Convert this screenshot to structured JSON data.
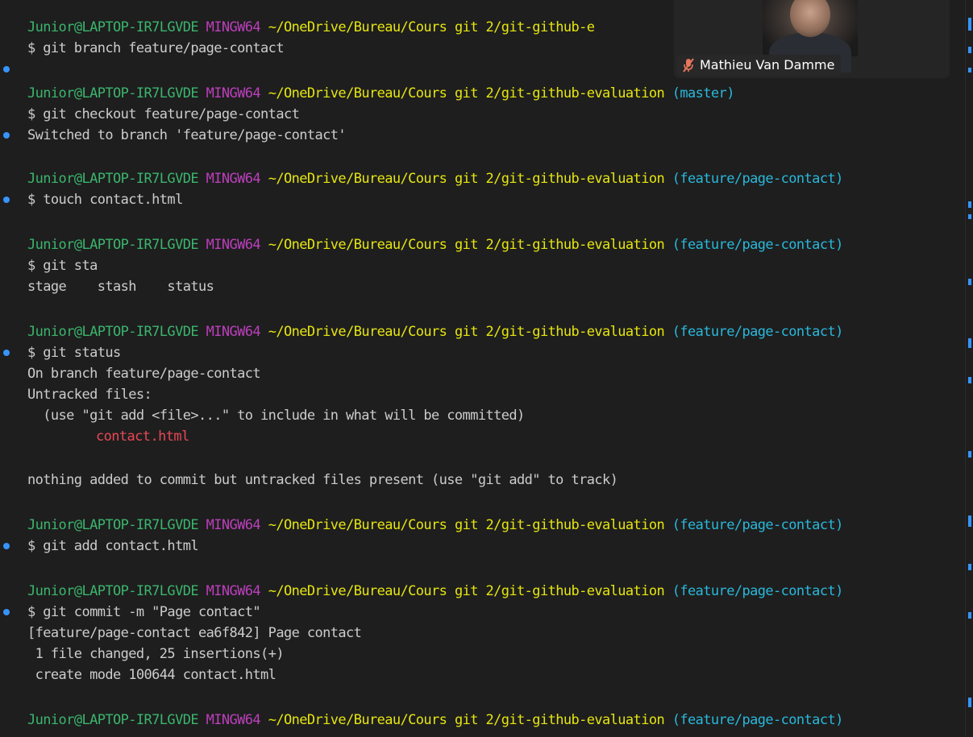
{
  "prompt": {
    "user": "Junior",
    "host": "@LAPTOP-IR7LGVDE",
    "system": "MINGW64",
    "path": "~/OneDrive/Bureau/Cours git 2/git-github-evaluation",
    "path_truncated": "~/OneDrive/Bureau/Cours git 2/git-github-e",
    "branch_master": "(master)",
    "branch_feature": "(feature/page-contact)"
  },
  "commands": {
    "c1": "$ git branch feature/page-contact",
    "c2": "$ git checkout feature/page-contact",
    "c3": "$ touch contact.html",
    "c4": "$ git sta",
    "c5": "$ git status",
    "c6": "$ git add contact.html",
    "c7": "$ git commit -m \"Page contact\""
  },
  "outputs": {
    "switched": "Switched to branch 'feature/page-contact'",
    "completions": "stage    stash    status",
    "on_branch": "On branch feature/page-contact",
    "untracked_header": "Untracked files:",
    "untracked_hint": "  (use \"git add <file>...\" to include in what will be committed)",
    "untracked_file": "contact.html",
    "nothing_added": "nothing added to commit but untracked files present (use \"git add\" to track)",
    "commit_header": "[feature/page-contact ea6f842] Page contact",
    "commit_stats": " 1 file changed, 25 insertions(+)",
    "commit_mode": " create mode 100644 contact.html"
  },
  "video_call": {
    "participant_name": "Mathieu Van Damme",
    "mic_icon": "mic-muted-icon"
  },
  "colors": {
    "background": "#1e1e1e",
    "user_green": "#3bb56d",
    "system_magenta": "#bc3fbc",
    "path_yellow": "#e5e510",
    "branch_cyan": "#29b8db",
    "untracked_red": "#e74856",
    "decoration_blue": "#3794ff"
  }
}
